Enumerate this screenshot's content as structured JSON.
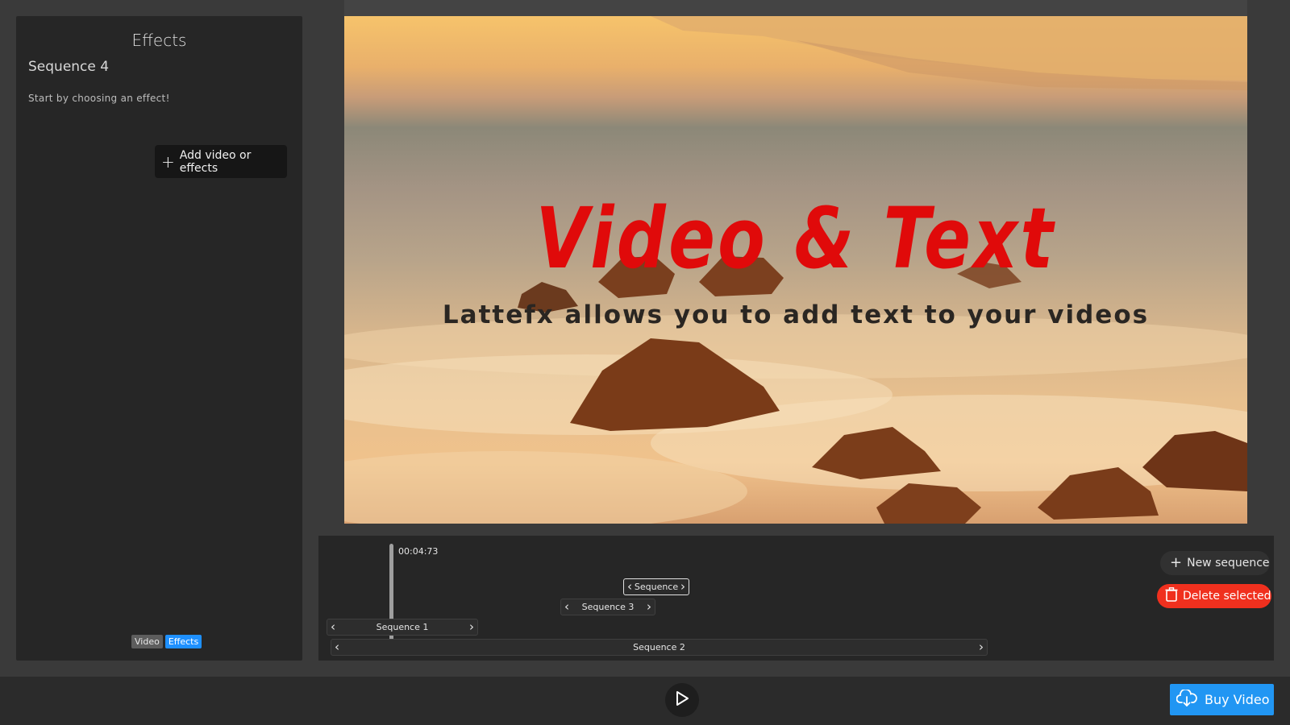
{
  "effects_panel": {
    "title": "Effects",
    "sequence_name": "Sequence 4",
    "hint": "Start by choosing an effect!",
    "add_button": "Add video or effects",
    "mode_video": "Video",
    "mode_effects": "Effects"
  },
  "preview": {
    "title": "Video & Text",
    "subtitle": "Lattefx allows you to add text to your videos",
    "title_color": "#e00a0a"
  },
  "timeline": {
    "playhead_time": "00:04:73",
    "clips": [
      {
        "label": "Sequence",
        "selected": true
      },
      {
        "label": "Sequence 3",
        "selected": false
      },
      {
        "label": "Sequence 1",
        "selected": false
      },
      {
        "label": "Sequence 2",
        "selected": false
      }
    ],
    "new_sequence": "New sequence",
    "delete_selected": "Delete selected"
  },
  "bottom_bar": {
    "buy_button": "Buy Video",
    "buy_color": "#2196f3",
    "delete_color": "#f0301e"
  }
}
